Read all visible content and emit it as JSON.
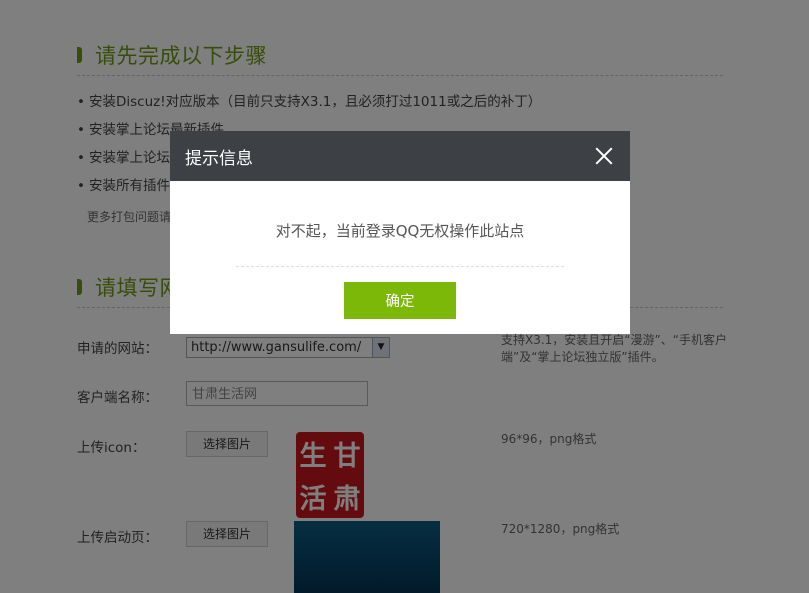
{
  "section1": {
    "title": "请先完成以下步骤",
    "steps": [
      "安装Discuz!对应版本（目前只支持X3.1，且必须打过1011或之后的补丁）",
      "安装掌上论坛最新插件",
      "安装掌上论坛",
      "安装所有插件"
    ],
    "more_link": "更多打包问题请"
  },
  "section2": {
    "title": "请填写网"
  },
  "form": {
    "site_label": "申请的网站：",
    "site_value": "http://www.gansulife.com/",
    "site_hint": "支持X3.1，安装且开启“漫游”、“手机客户端”及“掌上论坛独立版”插件。",
    "client_name_label": "客户端名称：",
    "client_name_value": "甘肃生活网",
    "icon_label": "上传icon：",
    "icon_button": "选择图片",
    "icon_hint": "96*96，png格式",
    "icon_image_text": [
      "生",
      "甘",
      "活",
      "肃"
    ],
    "launch_label": "上传启动页：",
    "launch_button": "选择图片",
    "launch_hint": "720*1280，png格式"
  },
  "modal": {
    "title": "提示信息",
    "message": "对不起，当前登录QQ无权操作此站点",
    "confirm_label": "确定"
  },
  "colors": {
    "accent_green": "#6f9a14",
    "button_green": "#7cb808",
    "modal_header": "#3d4145",
    "seal_red": "#c8161e"
  }
}
